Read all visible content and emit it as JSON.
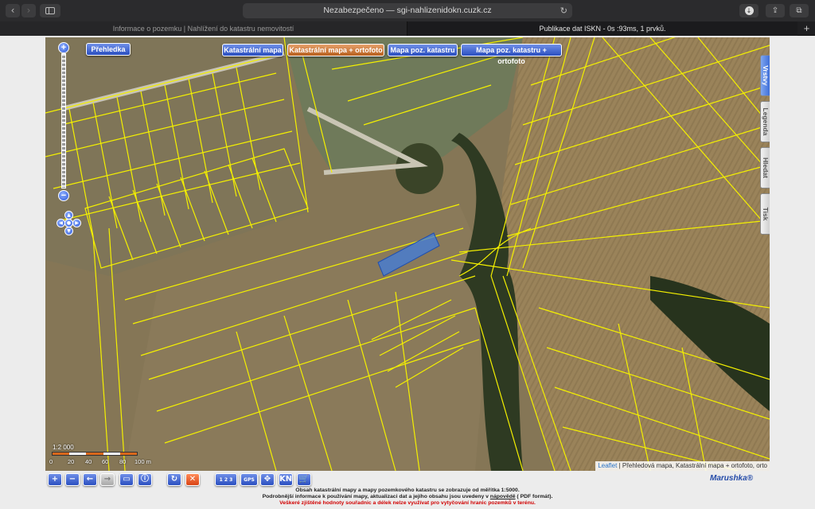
{
  "browser": {
    "back_icon": "‹",
    "forward_icon": "›",
    "address": "Nezabezpečeno — sgi-nahlizenidokn.cuzk.cz",
    "reload_icon": "↻",
    "download_icon": "↓",
    "share_icon": "⇪",
    "tabs_icon": "⧉",
    "tabs": [
      {
        "label": "Informace o pozemku | Nahlížení do katastru nemovitostí"
      },
      {
        "label": "Publikace dat ISKN - 0s :93ms, 1 prvků."
      }
    ],
    "new_tab_icon": "+"
  },
  "map": {
    "overview_label": "Přehledka",
    "layer_buttons": [
      {
        "label": "Katastrální mapa",
        "active": false
      },
      {
        "label": "Katastrální mapa + ortofoto",
        "active": true
      },
      {
        "label": "Mapa poz. katastru",
        "active": false
      },
      {
        "label": "Mapa poz. katastru + ortofoto",
        "active": false
      }
    ],
    "zoom_in": "+",
    "zoom_out": "−",
    "pan": {
      "up": "▲",
      "down": "▼",
      "left": "◀",
      "right": "▶",
      "center": "●"
    },
    "side_tabs": [
      {
        "label": "Vrstvy",
        "active": true
      },
      {
        "label": "Legenda",
        "active": false
      },
      {
        "label": "Hledat",
        "active": false
      },
      {
        "label": "Tisk",
        "active": false
      }
    ],
    "scale": {
      "ratio": "1:2 000",
      "labels": [
        "0",
        "20",
        "40",
        "60",
        "80",
        "100 m"
      ]
    },
    "attribution": {
      "link": "Leaflet",
      "text": "| Přehledová mapa, Katastrální mapa + ortofoto, orto"
    },
    "colors": {
      "parcel_line": "#f4f000",
      "selected_parcel": "#3f7de0"
    }
  },
  "toolbar": {
    "tools": [
      {
        "name": "zoom-in-tool",
        "glyph": "+",
        "style": "blue"
      },
      {
        "name": "zoom-out-tool",
        "glyph": "−",
        "style": "blue"
      },
      {
        "name": "back-tool",
        "glyph": "←",
        "style": "blue"
      },
      {
        "name": "forward-tool",
        "glyph": "→",
        "style": "gray"
      },
      {
        "name": "zoom-box-tool",
        "glyph": "▭",
        "style": "blue"
      },
      {
        "name": "info-tool",
        "glyph": "ⓘ",
        "style": "blue"
      },
      {
        "name": "refresh-tool",
        "glyph": "↻",
        "style": "blue"
      },
      {
        "name": "clear-tool",
        "glyph": "✕",
        "style": "orange"
      },
      {
        "name": "measure-tool",
        "glyph": "1 2 3",
        "style": "blue"
      },
      {
        "name": "gps-tool",
        "glyph": "GPS",
        "style": "blue"
      },
      {
        "name": "compass-tool",
        "glyph": "✥",
        "style": "blue"
      },
      {
        "name": "kn-tool",
        "glyph": "KN",
        "style": "blue"
      },
      {
        "name": "cart-tool",
        "glyph": "🛒",
        "style": "blue"
      }
    ],
    "brand": "Marushka®"
  },
  "notes": {
    "line1": "Obsah katastrální mapy a mapy pozemkového katastru se zobrazuje od měřítka 1:5000.",
    "line2_a": "Podrobnější informace k používání mapy, aktualizaci dat a jejího obsahu jsou uvedeny v",
    "line2_link": "nápovědě",
    "line2_b": "( PDF formát).",
    "warning": "Veškeré zjištěné hodnoty souřadnic a délek nelze využívat pro vytyčování hranic pozemků v terénu."
  }
}
